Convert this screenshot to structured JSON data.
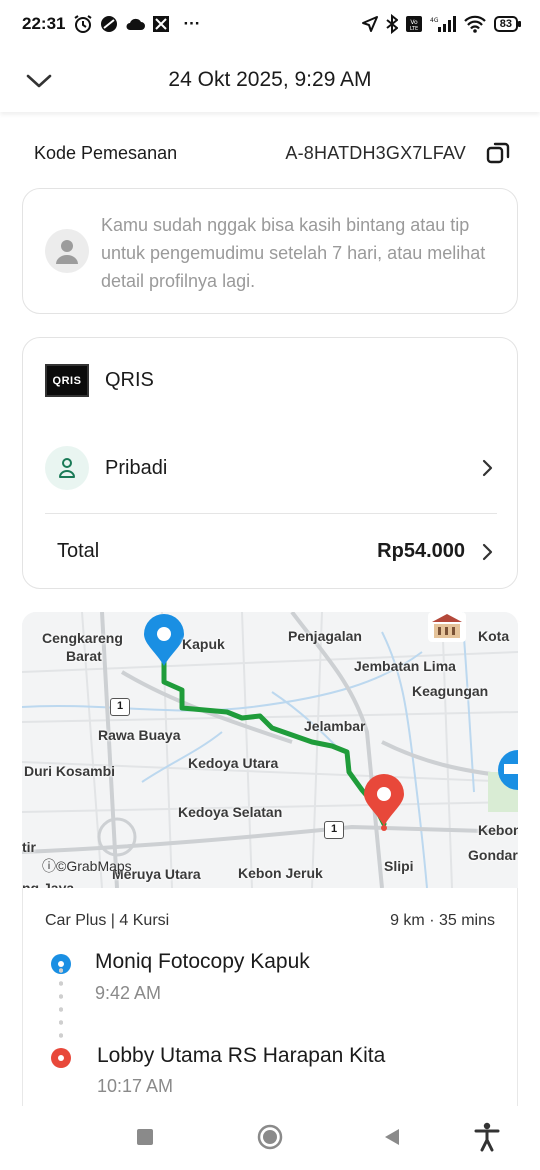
{
  "status_bar": {
    "time": "22:31",
    "more": "···",
    "battery": "83"
  },
  "header": {
    "title": "24 Okt 2025, 9:29 AM"
  },
  "booking": {
    "label": "Kode Pemesanan",
    "code": "A-8HATDH3GX7LFAV"
  },
  "info": {
    "message": "Kamu sudah nggak bisa kasih bintang atau tip untuk pengemudimu setelah 7 hari, atau melihat detail profilnya lagi."
  },
  "payment": {
    "method_logo": "QRIS",
    "method": "QRIS",
    "profile": "Pribadi",
    "total_label": "Total",
    "total_value": "Rp54.000"
  },
  "map": {
    "labels": {
      "cengkareng": "Cengkareng",
      "barat": "Barat",
      "kapuk": "Kapuk",
      "penjagalan": "Penjagalan",
      "kota": "Kota",
      "jembatan_lima": "Jembatan Lima",
      "keagungan": "Keagungan",
      "rawa_buaya": "Rawa Buaya",
      "jelambar": "Jelambar",
      "duri_kosambi": "Duri Kosambi",
      "kedoya_utara": "Kedoya Utara",
      "kedoya_selatan": "Kedoya Selatan",
      "tir": "tir",
      "meruya_utara": "Meruya Utara",
      "kebon_jeruk": "Kebon Jeruk",
      "slipi": "Slipi",
      "kebon": "Kebon",
      "gondar": "Gondar",
      "jakarta_partial": "ng Jaya"
    },
    "shield_1": "1",
    "shield_2": "1",
    "attribution": "ⓘ©GrabMaps",
    "route_color": "#1f9c3a",
    "pickup_pin_color": "#1a8fe3",
    "dropoff_pin_color": "#e8483a"
  },
  "trip": {
    "vehicle": "Car Plus | 4 Kursi",
    "distance_time": "9 km · 35 mins",
    "pickup_name": "Moniq Fotocopy Kapuk",
    "pickup_time": "9:42 AM",
    "dropoff_name": "Lobby Utama RS Harapan Kita",
    "dropoff_time": "10:17 AM"
  }
}
